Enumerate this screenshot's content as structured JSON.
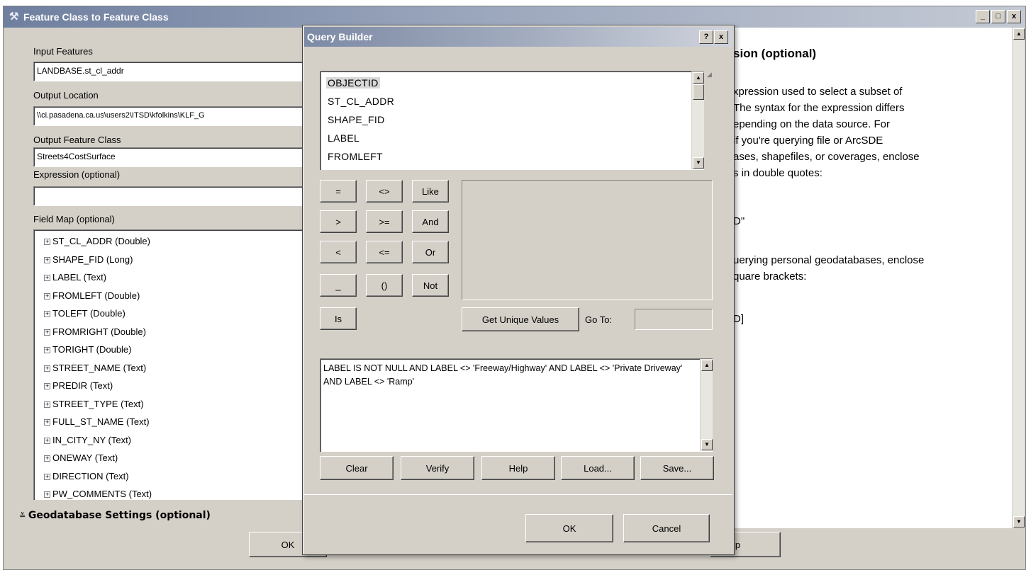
{
  "main_window": {
    "title": "Feature Class to Feature Class",
    "controls": {
      "minimize": "_",
      "maximize": "□",
      "close": "x"
    },
    "input_features": {
      "label": "Input Features",
      "value": "LANDBASE.st_cl_addr"
    },
    "output_location": {
      "label": "Output Location",
      "value": "\\\\ci.pasadena.ca.us\\users2\\ITSD\\kfolkins\\KLF_G"
    },
    "output_feature_class": {
      "label": "Output Feature Class",
      "value": "Streets4CostSurface"
    },
    "expression": {
      "label": "Expression (optional)",
      "value": ""
    },
    "field_map": {
      "label": "Field Map (optional)",
      "items": [
        "ST_CL_ADDR (Double)",
        "SHAPE_FID (Long)",
        "LABEL (Text)",
        "FROMLEFT (Double)",
        "TOLEFT (Double)",
        "FROMRIGHT (Double)",
        "TORIGHT (Double)",
        "STREET_NAME (Text)",
        "PREDIR (Text)",
        "STREET_TYPE (Text)",
        "FULL_ST_NAME (Text)",
        "IN_CITY_NY (Text)",
        "ONEWAY (Text)",
        "DIRECTION (Text)",
        "PW_COMMENTS (Text)"
      ]
    },
    "geodatabase_settings": "Geodatabase Settings (optional)",
    "ok_label": "OK",
    "help_fragment": "lp"
  },
  "help_panel": {
    "title": "sion (optional)",
    "lines": [
      "xpression used to select a subset of",
      "The syntax for the expression differs",
      "epending on the data source. For",
      "if you're querying file or ArcSDE",
      "ases, shapefiles, or coverages, enclose",
      "s in double quotes:",
      "",
      "D\"",
      "",
      "uerying personal geodatabases, enclose",
      "quare brackets:",
      "",
      "D]"
    ]
  },
  "query_builder": {
    "title": "Query Builder",
    "controls": {
      "help": "?",
      "close": "x"
    },
    "fields": [
      "OBJECTID",
      "ST_CL_ADDR",
      "SHAPE_FID",
      "LABEL",
      "FROMLEFT"
    ],
    "selected_field": "OBJECTID",
    "operators": {
      "eq": "=",
      "ne": "<>",
      "like": "Like",
      "gt": ">",
      "ge": ">=",
      "and": "And",
      "lt": "<",
      "le": "<=",
      "or": "Or",
      "underscore": "_",
      "parens": "()",
      "not": "Not",
      "is": "Is"
    },
    "get_unique_values": "Get Unique Values",
    "go_to": {
      "label": "Go To:",
      "value": ""
    },
    "expression": "LABEL IS NOT NULL AND LABEL <> 'Freeway/Highway' AND LABEL <> 'Private Driveway' AND LABEL <> 'Ramp'",
    "action_buttons": {
      "clear": "Clear",
      "verify": "Verify",
      "help": "Help",
      "load": "Load...",
      "save": "Save..."
    },
    "ok": "OK",
    "cancel": "Cancel"
  }
}
